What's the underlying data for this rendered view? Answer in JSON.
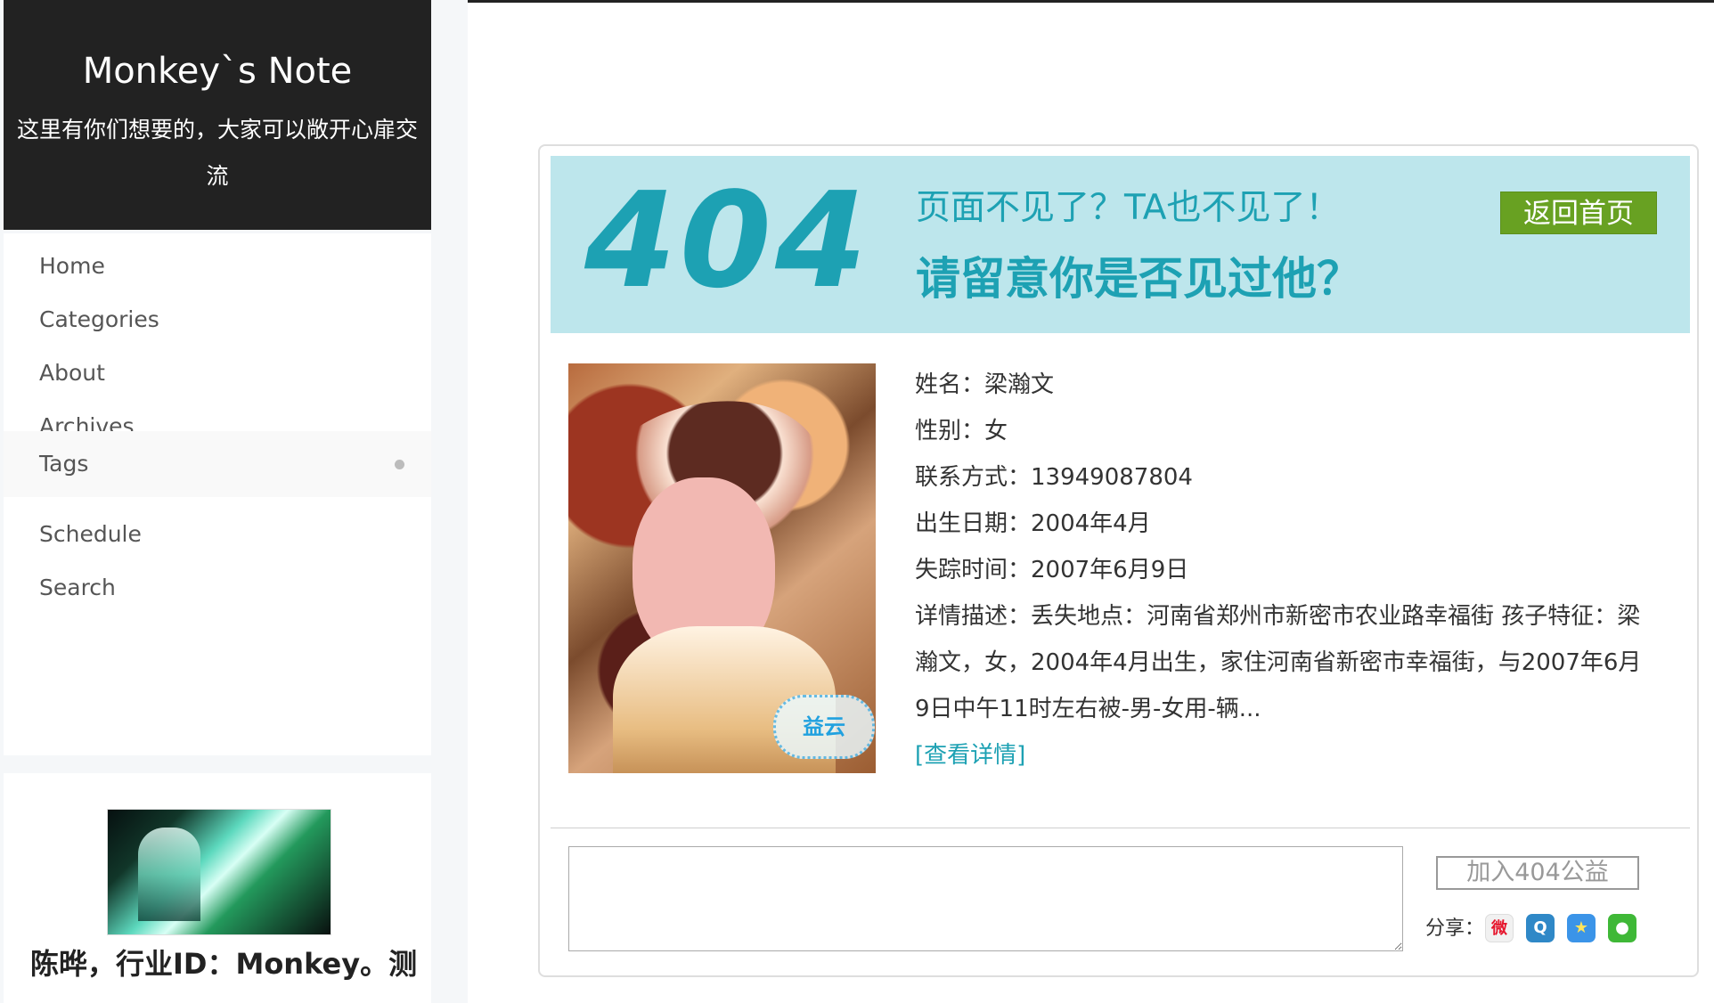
{
  "sidebar": {
    "site_title": "Monkey`s Note",
    "site_subtitle": "这里有你们想要的，大家可以敞开心扉交流",
    "menu": [
      {
        "label": "Home"
      },
      {
        "label": "Categories"
      },
      {
        "label": "About"
      },
      {
        "label": "Archives"
      },
      {
        "label": "Tags",
        "active": true
      },
      {
        "label": "Schedule"
      },
      {
        "label": "Search"
      }
    ],
    "author_text": "陈晔，行业ID：Monkey。测"
  },
  "missing_page": {
    "code": "404",
    "headline_1": "页面不见了？TA也不见了！",
    "headline_2": "请留意你是否见过他？",
    "home_button": "返回首页",
    "photo_watermark": "益云",
    "details": {
      "name": "姓名：梁瀚文",
      "gender": "性别：女",
      "contact": "联系方式：13949087804",
      "birth_date": "出生日期：2004年4月",
      "missing_time": "失踪时间：2007年6月9日",
      "description": "详情描述：丢失地点：河南省郑州市新密市农业路幸福街 孩子特征：梁瀚文，女，2004年4月出生，家住河南省新密市幸福街，与2007年6月9日中午11时左右被-男-女用-辆...",
      "more_link": "[查看详情]"
    },
    "join_button": "加入404公益",
    "share_label": "分享：",
    "share_icons": [
      "weibo-icon",
      "qzone-icon",
      "qq-icon",
      "wechat-icon"
    ]
  },
  "colors": {
    "sidebar_dark": "#222222",
    "banner": "#bde6ec",
    "teal": "#1da1b3",
    "home_button": "#68a122"
  }
}
